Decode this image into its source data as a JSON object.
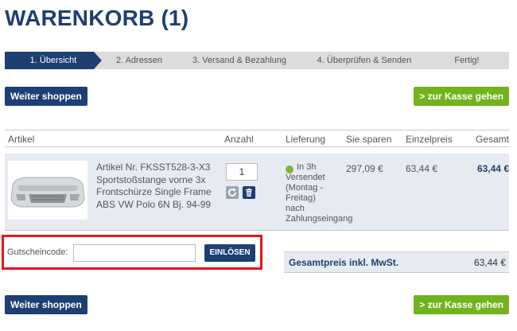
{
  "page": {
    "title": "WARENKORB (1)"
  },
  "steps": [
    {
      "label": "1. Übersicht",
      "active": true
    },
    {
      "label": "2. Adressen",
      "active": false
    },
    {
      "label": "3. Versand & Bezahlung",
      "active": false
    },
    {
      "label": "4. Überprüfen & Senden",
      "active": false
    },
    {
      "label": "Fertig!",
      "active": false
    }
  ],
  "actions": {
    "continue_shopping": "Weiter shoppen",
    "checkout": "> zur Kasse gehen"
  },
  "table": {
    "headers": {
      "article": "Artikel",
      "quantity": "Anzahl",
      "delivery": "Lieferung",
      "savings": "Sie sparen",
      "unit_price": "Einzelpreis",
      "total": "Gesamt"
    }
  },
  "item": {
    "description_lines": [
      "Artikel Nr. FKSST528-3-X3",
      "Sportstoßstange vorne 3x",
      "Frontschürze Single Frame",
      "ABS VW Polo 6N Bj. 94-99"
    ],
    "quantity": "1",
    "delivery_lines": [
      "In 3h",
      "Versendet",
      "(Montag -",
      "Freitag)",
      "nach",
      "Zahlungseingang"
    ],
    "savings": "297,09 €",
    "unit_price": "63,44 €",
    "total": "63,44 €",
    "status_color": "#78b833"
  },
  "voucher": {
    "label": "Gutscheincode:",
    "value": "",
    "redeem_label": "EINLÖSEN"
  },
  "summary": {
    "label": "Gesamtpreis inkl. MwSt.",
    "value": "63,44 €"
  },
  "colors": {
    "brand_blue": "#1e3f74",
    "checkout_green": "#72b31d",
    "highlight_red": "#e8141c"
  }
}
